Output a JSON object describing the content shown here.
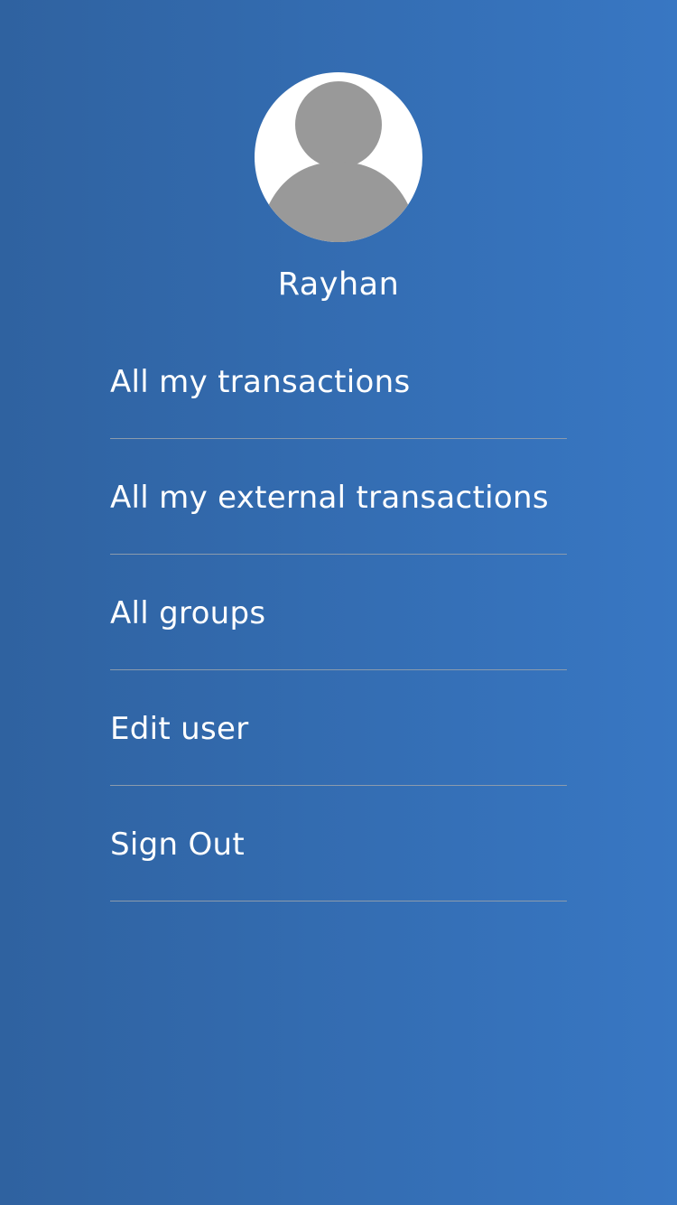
{
  "colors": {
    "background_start": "#2f62a0",
    "background_end": "#3877c3",
    "text": "#ffffff",
    "divider": "#8b9bad",
    "avatar_background": "#ffffff",
    "avatar_figure": "#999999"
  },
  "profile": {
    "avatar_icon": "user-avatar-icon",
    "name": "Rayhan"
  },
  "menu": {
    "items": [
      {
        "label": "All my transactions"
      },
      {
        "label": "All my external transactions"
      },
      {
        "label": "All groups"
      },
      {
        "label": "Edit user"
      },
      {
        "label": "Sign Out"
      }
    ]
  }
}
